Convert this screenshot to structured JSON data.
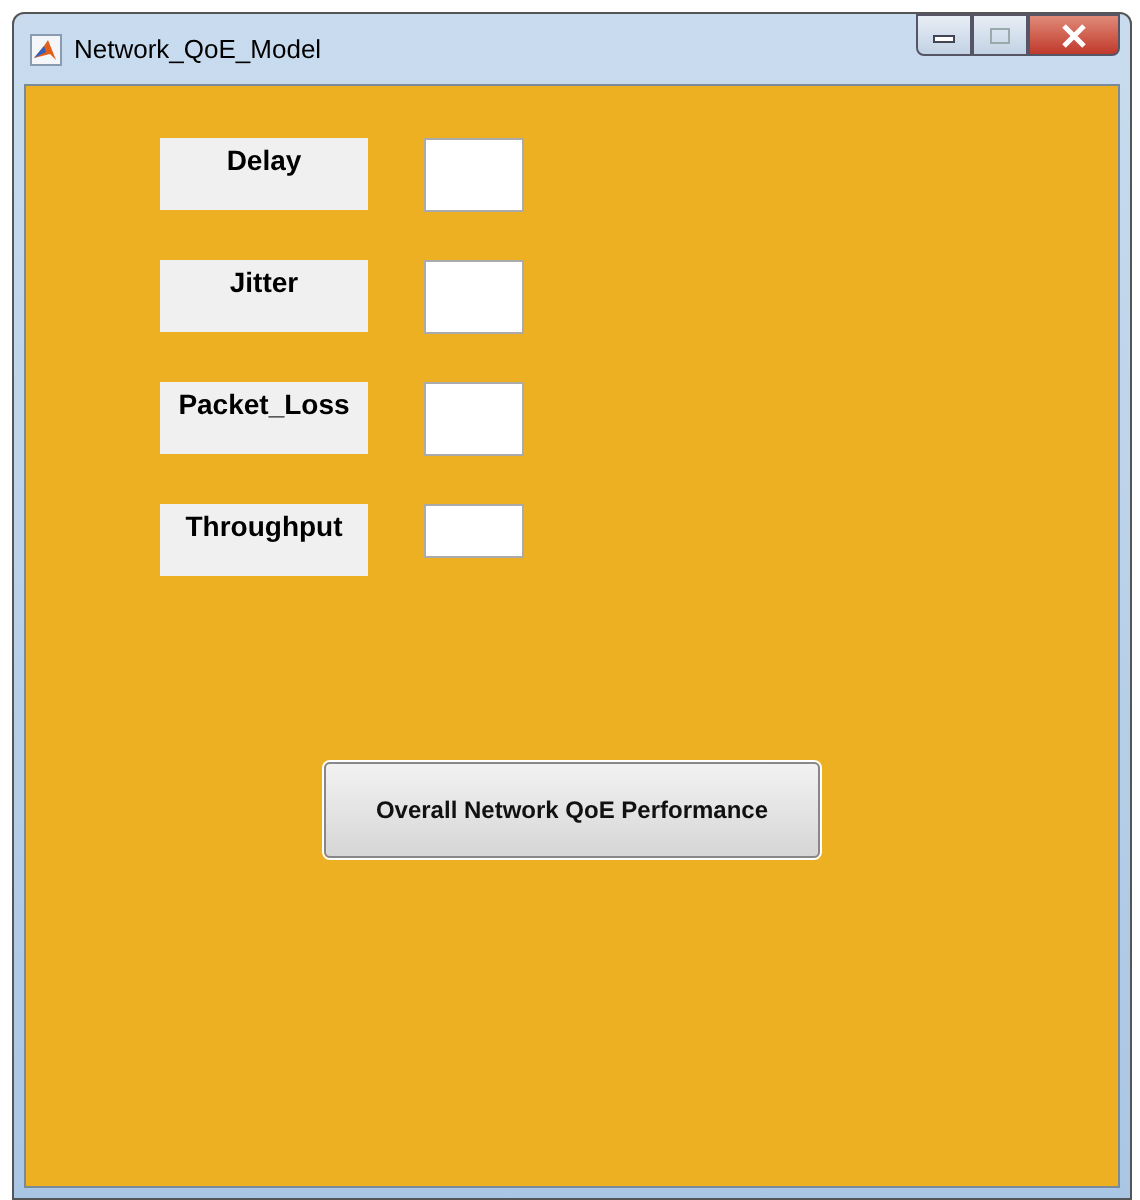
{
  "window": {
    "title": "Network_QoE_Model"
  },
  "fields": [
    {
      "label": "Delay"
    },
    {
      "label": "Jitter"
    },
    {
      "label": "Packet_Loss"
    },
    {
      "label": "Throughput"
    }
  ],
  "buttons": [
    "Overall Network QoE Performance"
  ]
}
